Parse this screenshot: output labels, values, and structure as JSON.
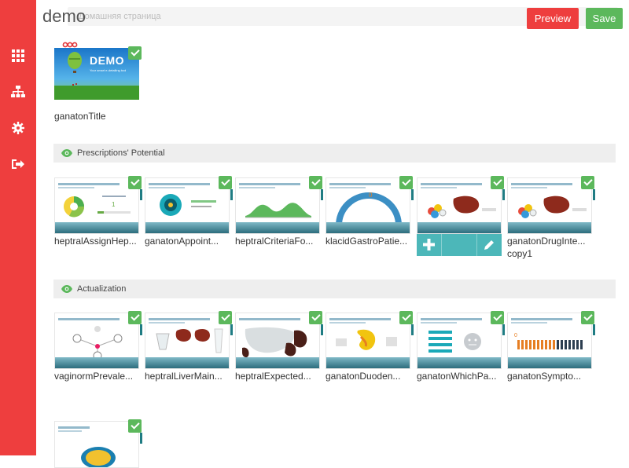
{
  "app": {
    "title": "demo",
    "breadcrumb": "Домашняя страница"
  },
  "toolbar": {
    "preview_label": "Preview",
    "save_label": "Save"
  },
  "sidebar": {
    "items": [
      {
        "icon": "grid-icon"
      },
      {
        "icon": "sitemap-icon"
      },
      {
        "icon": "gear-icon"
      },
      {
        "icon": "sign-out-icon"
      }
    ]
  },
  "title_slide": {
    "label": "ganatonTitle",
    "demo_text": "DEMO",
    "tagline": "Your smart e-detailing tool"
  },
  "sections": [
    {
      "title": "Prescriptions' Potential",
      "slides": [
        {
          "label": "heptralAssignHep..."
        },
        {
          "label": "ganatonAppoint..."
        },
        {
          "label": "heptralCriteriaFo..."
        },
        {
          "label": "klacidGastroPatie..."
        },
        {
          "label": ""
        },
        {
          "label": "ganatonDrugInte...",
          "label2": "copy1"
        }
      ]
    },
    {
      "title": "Actualization",
      "slides": [
        {
          "label": "vaginormPrevale..."
        },
        {
          "label": "heptralLiverMain..."
        },
        {
          "label": "heptralExpected..."
        },
        {
          "label": "ganatonDuoden..."
        },
        {
          "label": "ganatonWhichPa..."
        },
        {
          "label": "ganatonSympto..."
        },
        {
          "label": ""
        }
      ]
    }
  ],
  "colors": {
    "accent": "#ee3e3e",
    "success": "#5cb85c",
    "overlay": "#4cb7b9"
  }
}
